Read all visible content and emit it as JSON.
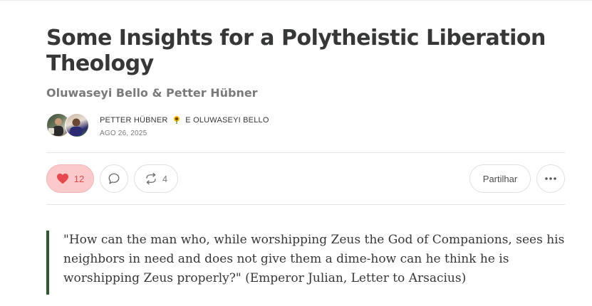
{
  "post": {
    "title": "Some Insights for a Polytheistic Liberation Theology",
    "subtitle": "Oluwaseyi Bello & Petter Hübner"
  },
  "byline": {
    "author1": "Petter Hübner",
    "author_icon": "sunflower-emoji",
    "author_separator": " e ",
    "author2": "Oluwaseyi Bello",
    "date": "ago 26, 2025"
  },
  "actions": {
    "like_count": "12",
    "restack_count": "4",
    "share_label": "Partilhar",
    "like_color": "#e5484d"
  },
  "quote": {
    "text": "\"How can the man who, while worshipping Zeus the God of Companions, sees his neighbors in need and does not give them a dime-how can he think he is worshipping Zeus properly?\" (Emperor Julian, Letter to Arsacius)",
    "border_color": "#2f5c2c"
  }
}
